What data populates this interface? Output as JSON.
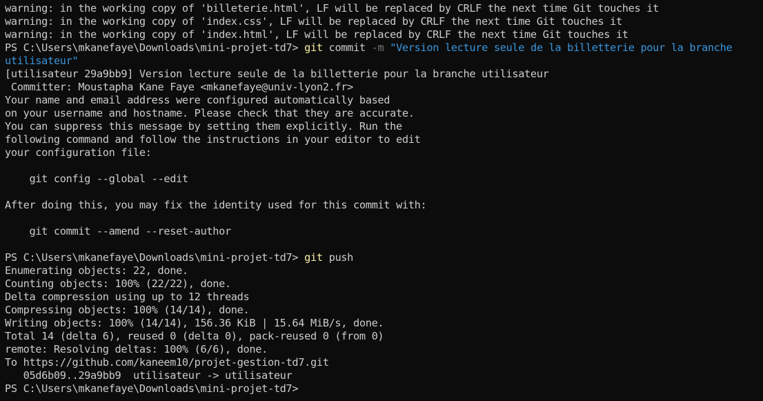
{
  "terminal": {
    "output_before_commit": [
      "warning: in the working copy of 'billeterie.html', LF will be replaced by CRLF the next time Git touches it",
      "warning: in the working copy of 'index.css', LF will be replaced by CRLF the next time Git touches it",
      "warning: in the working copy of 'index.html', LF will be replaced by CRLF the next time Git touches it"
    ],
    "commit_command": {
      "prompt": "PS C:\\Users\\mkanefaye\\Downloads\\mini-projet-td7> ",
      "command": "git",
      "subcommand": " commit ",
      "flag": "-m",
      "message": " \"Version lecture seule de la billetterie pour la branche utilisateur\""
    },
    "commit_output": [
      "[utilisateur 29a9bb9] Version lecture seule de la billetterie pour la branche utilisateur",
      " Committer: Moustapha Kane Faye <mkanefaye@univ-lyon2.fr>",
      "Your name and email address were configured automatically based",
      "on your username and hostname. Please check that they are accurate.",
      "You can suppress this message by setting them explicitly. Run the",
      "following command and follow the instructions in your editor to edit",
      "your configuration file:",
      "",
      "    git config --global --edit",
      "",
      "After doing this, you may fix the identity used for this commit with:",
      "",
      "    git commit --amend --reset-author",
      ""
    ],
    "push_command": {
      "prompt": "PS C:\\Users\\mkanefaye\\Downloads\\mini-projet-td7> ",
      "command": "git",
      "args": " push"
    },
    "push_output": [
      "Enumerating objects: 22, done.",
      "Counting objects: 100% (22/22), done.",
      "Delta compression using up to 12 threads",
      "Compressing objects: 100% (14/14), done.",
      "Writing objects: 100% (14/14), 156.36 KiB | 15.64 MiB/s, done.",
      "Total 14 (delta 6), reused 0 (delta 0), pack-reused 0 (from 0)",
      "remote: Resolving deltas: 100% (6/6), done.",
      "To https://github.com/kaneem10/projet-gestion-td7.git",
      "   05d6b09..29a9bb9  utilisateur -> utilisateur"
    ],
    "final_prompt": "PS C:\\Users\\mkanefaye\\Downloads\\mini-projet-td7>"
  },
  "colors": {
    "background": "#0c0c0c",
    "foreground": "#cccccc",
    "command": "#f9f1a5",
    "flag": "#767676",
    "string": "#3a96dd"
  }
}
